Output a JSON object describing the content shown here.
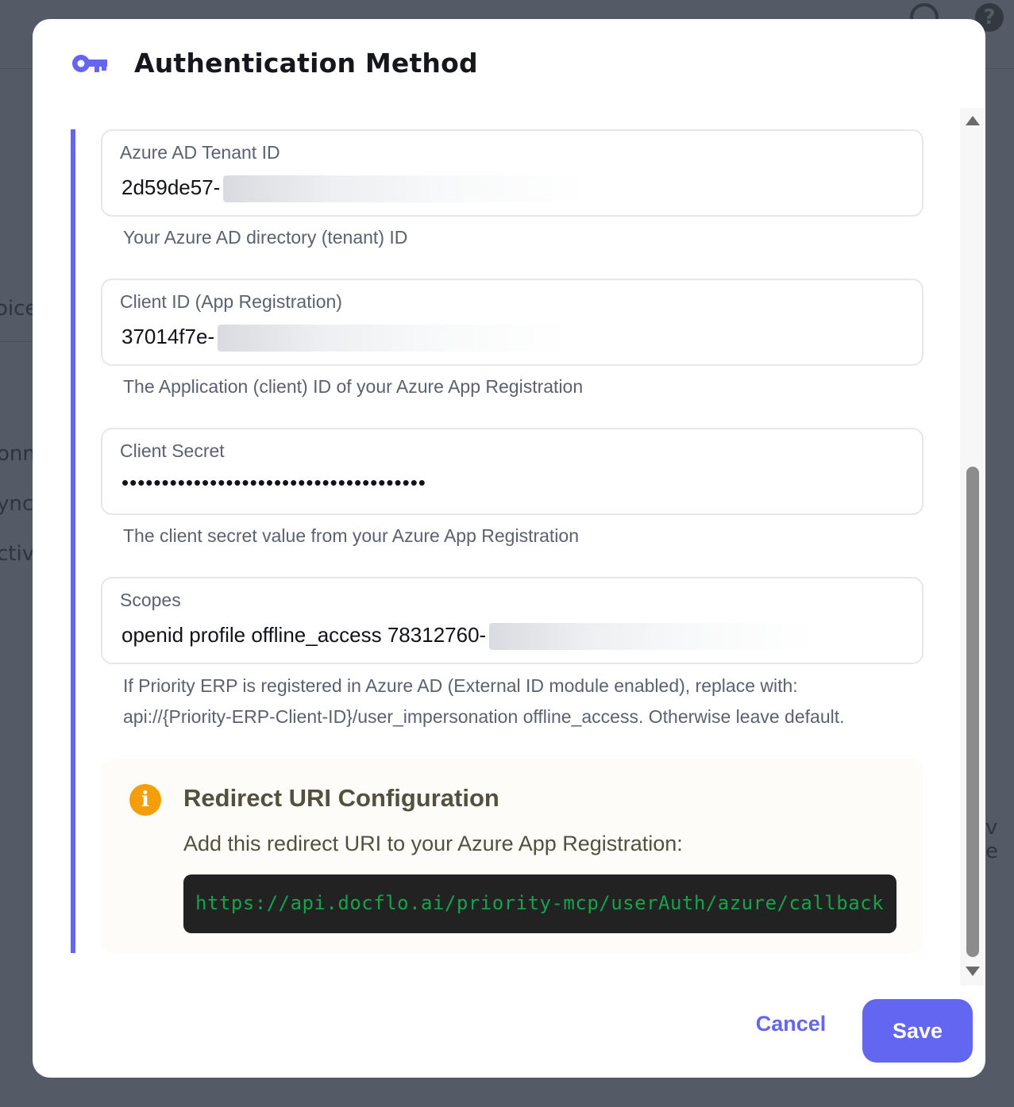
{
  "backdrop": {
    "frag_1": "oice",
    "frag_2": "onn",
    "frag_3": "ync:",
    "frag_4": "ctiv",
    "frag_5": "v e"
  },
  "modal": {
    "title": "Authentication Method",
    "fields": [
      {
        "label": "Azure AD Tenant ID",
        "value": "2d59de57-",
        "hint": "Your Azure AD directory (tenant) ID"
      },
      {
        "label": "Client ID (App Registration)",
        "value": "37014f7e-",
        "hint": "The Application (client) ID of your Azure App Registration"
      },
      {
        "label": "Client Secret",
        "value": "••••••••••••••••••••••••••••••••••••••",
        "hint": "The client secret value from your Azure App Registration"
      },
      {
        "label": "Scopes",
        "value": "openid profile offline_access 78312760-",
        "hint_line_1": "If Priority ERP is registered in Azure AD (External ID module enabled), replace with:",
        "hint_line_2": "api://{Priority-ERP-Client-ID}/user_impersonation offline_access. Otherwise leave default."
      }
    ],
    "redirect": {
      "title": "Redirect URI Configuration",
      "text": "Add this redirect URI to your Azure App Registration:",
      "uri": "https://api.docflo.ai/priority-mcp/userAuth/azure/callback",
      "accent": "#f59e0b"
    },
    "actions": {
      "cancel_label": "Cancel",
      "save_label": "Save"
    },
    "accent_color": "#6366f1"
  }
}
